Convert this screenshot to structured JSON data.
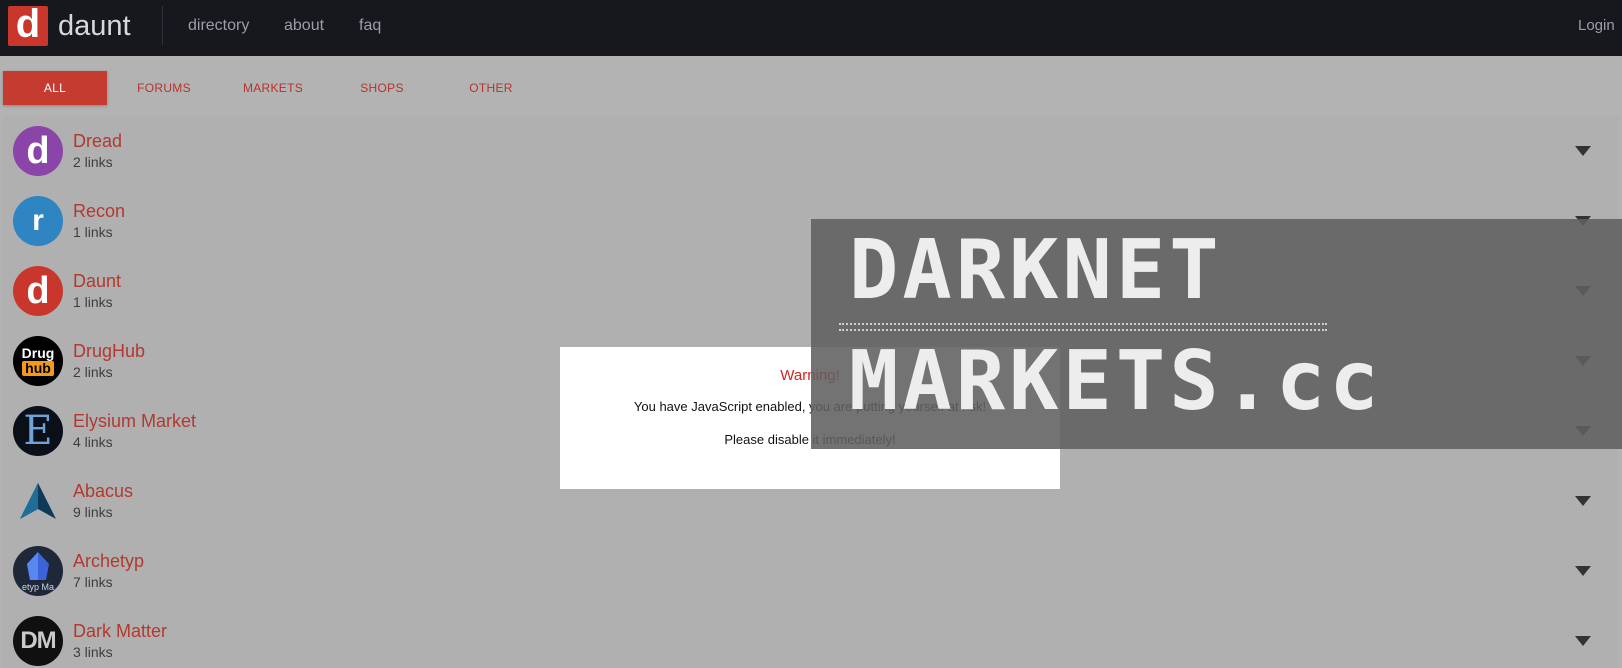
{
  "header": {
    "logo_letter": "d",
    "brand": "daunt",
    "nav": [
      "directory",
      "about",
      "faq"
    ],
    "login": "Login"
  },
  "tabs": [
    {
      "label": "ALL",
      "active": true
    },
    {
      "label": "FORUMS",
      "active": false
    },
    {
      "label": "MARKETS",
      "active": false
    },
    {
      "label": "SHOPS",
      "active": false
    },
    {
      "label": "OTHER",
      "active": false
    }
  ],
  "entries": [
    {
      "name": "Dread",
      "links": "2 links",
      "avatar_text": "d"
    },
    {
      "name": "Recon",
      "links": "1 links",
      "avatar_text": "r"
    },
    {
      "name": "Daunt",
      "links": "1 links",
      "avatar_text": "d"
    },
    {
      "name": "DrugHub",
      "links": "2 links",
      "avatar_text": "Drug hub"
    },
    {
      "name": "Elysium Market",
      "links": "4 links",
      "avatar_text": "E"
    },
    {
      "name": "Abacus",
      "links": "9 links",
      "avatar_text": ""
    },
    {
      "name": "Archetyp",
      "links": "7 links",
      "avatar_text": "etyp Ma"
    },
    {
      "name": "Dark Matter",
      "links": "3 links",
      "avatar_text": "DM"
    }
  ],
  "modal": {
    "title": "Warning!",
    "line1": "You have JavaScript enabled, you are putting yourself at risk!",
    "line2": "Please disable it immediately!"
  },
  "watermark": {
    "line1": "DARKNET",
    "line2": "MARKETS.cc"
  },
  "colors": {
    "accent": "#c63b30",
    "navbar": "#16181d",
    "background": "#b3b3b3"
  }
}
